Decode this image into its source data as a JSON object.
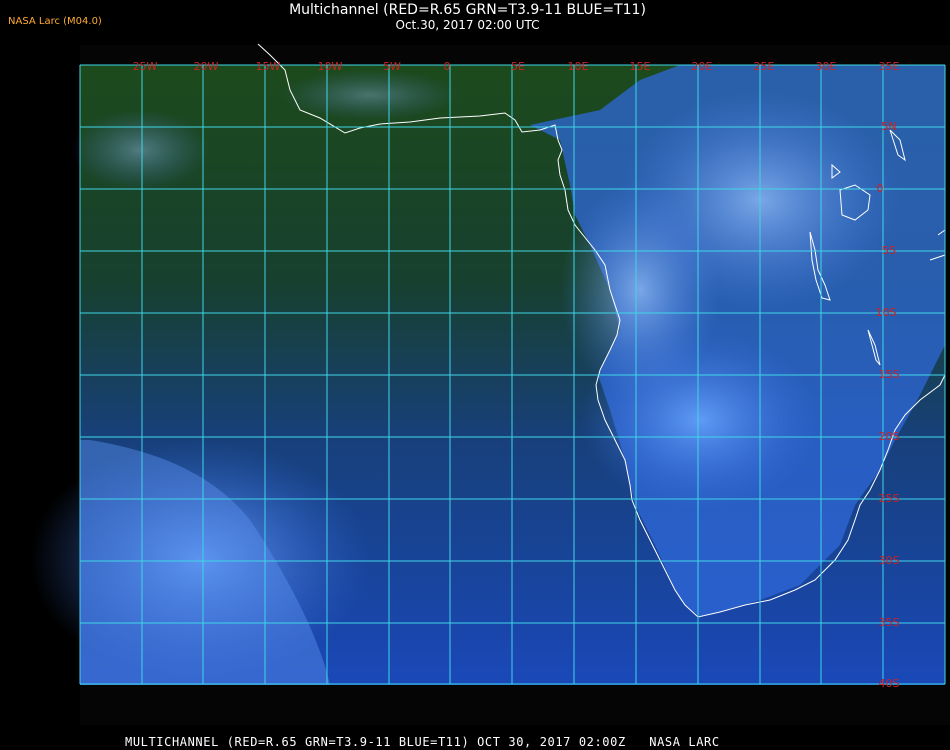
{
  "header": {
    "org": "NASA Larc (M04.0)",
    "title": "Multichannel (RED=R.65 GRN=T3.9-11 BLUE=T11)",
    "datetime": "Oct.30, 2017 02:00 UTC"
  },
  "footer": {
    "caption": "MULTICHANNEL (RED=R.65 GRN=T3.9-11 BLUE=T11) OCT 30, 2017 02:00Z   NASA LARC"
  },
  "map": {
    "grid_color": "#3fd6e8",
    "coast_color": "#ffffff",
    "label_color": "#cc2222",
    "longitude_labels": [
      "25W",
      "20W",
      "15W",
      "10W",
      "5W",
      "0",
      "5E",
      "10E",
      "15E",
      "20E",
      "25E",
      "30E",
      "35E"
    ],
    "latitude_labels": [
      "5N",
      "0",
      "5S",
      "10S",
      "15S",
      "20S",
      "25S",
      "30S",
      "35S",
      "40S"
    ]
  }
}
